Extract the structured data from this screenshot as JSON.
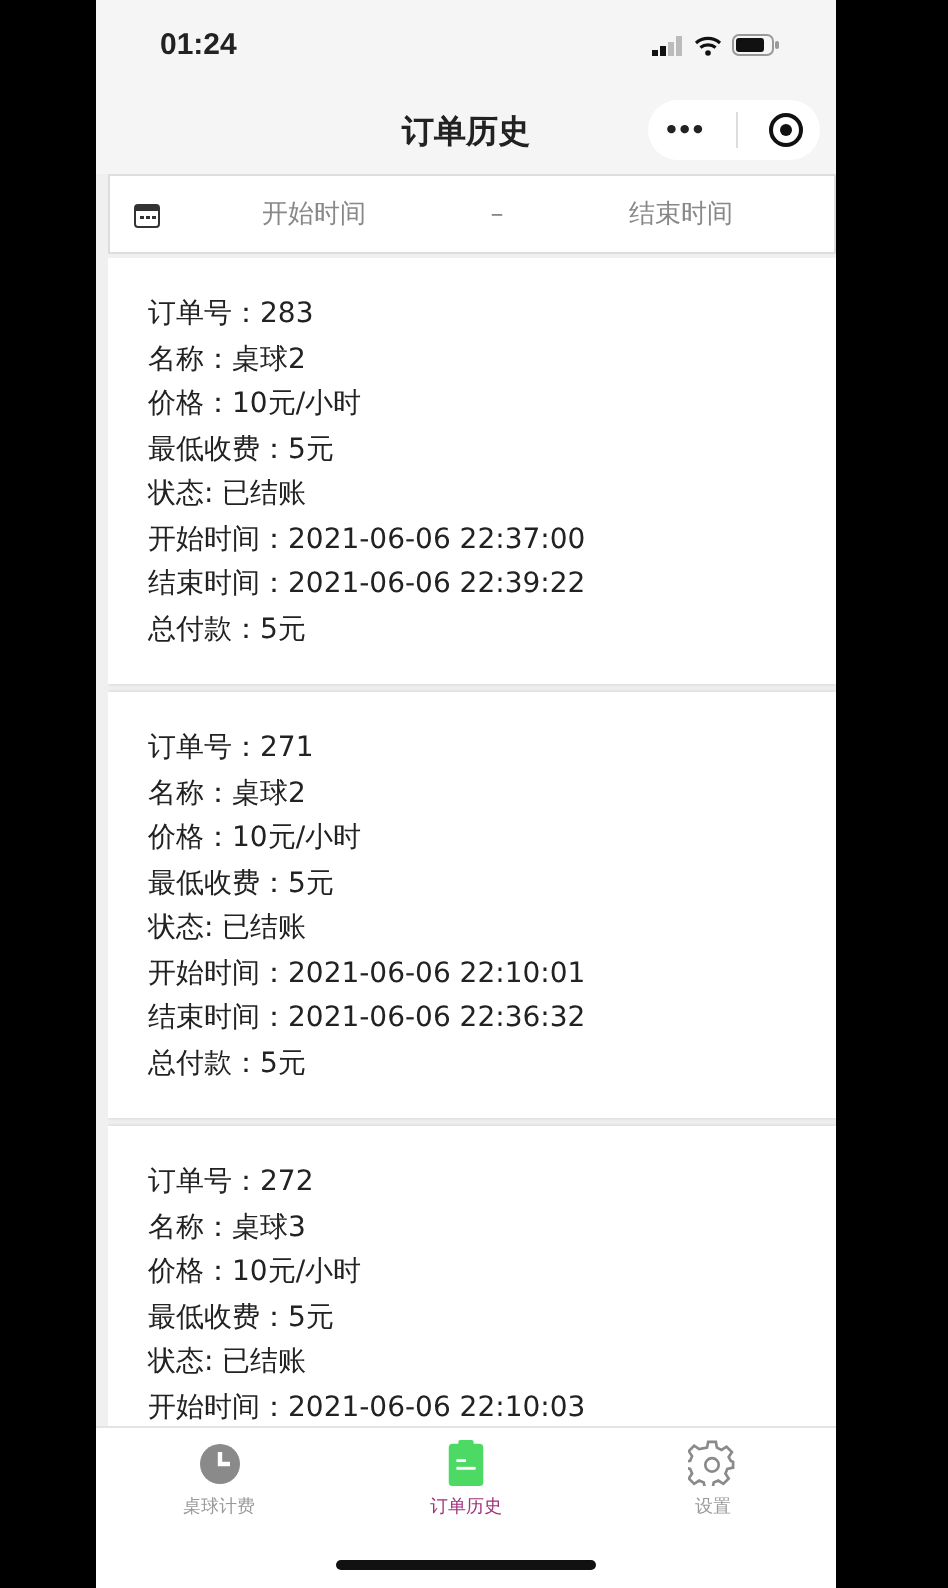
{
  "status_bar": {
    "time": "01:24"
  },
  "nav": {
    "title": "订单历史",
    "more": "•••"
  },
  "filter": {
    "start_placeholder": "开始时间",
    "separator": "–",
    "end_placeholder": "结束时间"
  },
  "orders": [
    {
      "lines": [
        "订单号：283",
        "名称：桌球2",
        "价格：10元/小时",
        "最低收费：5元",
        "状态: 已结账",
        "开始时间：2021-06-06 22:37:00",
        "结束时间：2021-06-06 22:39:22",
        "总付款：5元"
      ]
    },
    {
      "lines": [
        "订单号：271",
        "名称：桌球2",
        "价格：10元/小时",
        "最低收费：5元",
        "状态: 已结账",
        "开始时间：2021-06-06 22:10:01",
        "结束时间：2021-06-06 22:36:32",
        "总付款：5元"
      ]
    },
    {
      "lines": [
        "订单号：272",
        "名称：桌球3",
        "价格：10元/小时",
        "最低收费：5元",
        "状态: 已结账",
        "开始时间：2021-06-06 22:10:03"
      ]
    }
  ],
  "tabs": [
    {
      "kind": "clock",
      "label": "桌球计费",
      "selected": false
    },
    {
      "kind": "clipboard",
      "label": "订单历史",
      "selected": true
    },
    {
      "kind": "gear",
      "label": "设置",
      "selected": false
    }
  ]
}
